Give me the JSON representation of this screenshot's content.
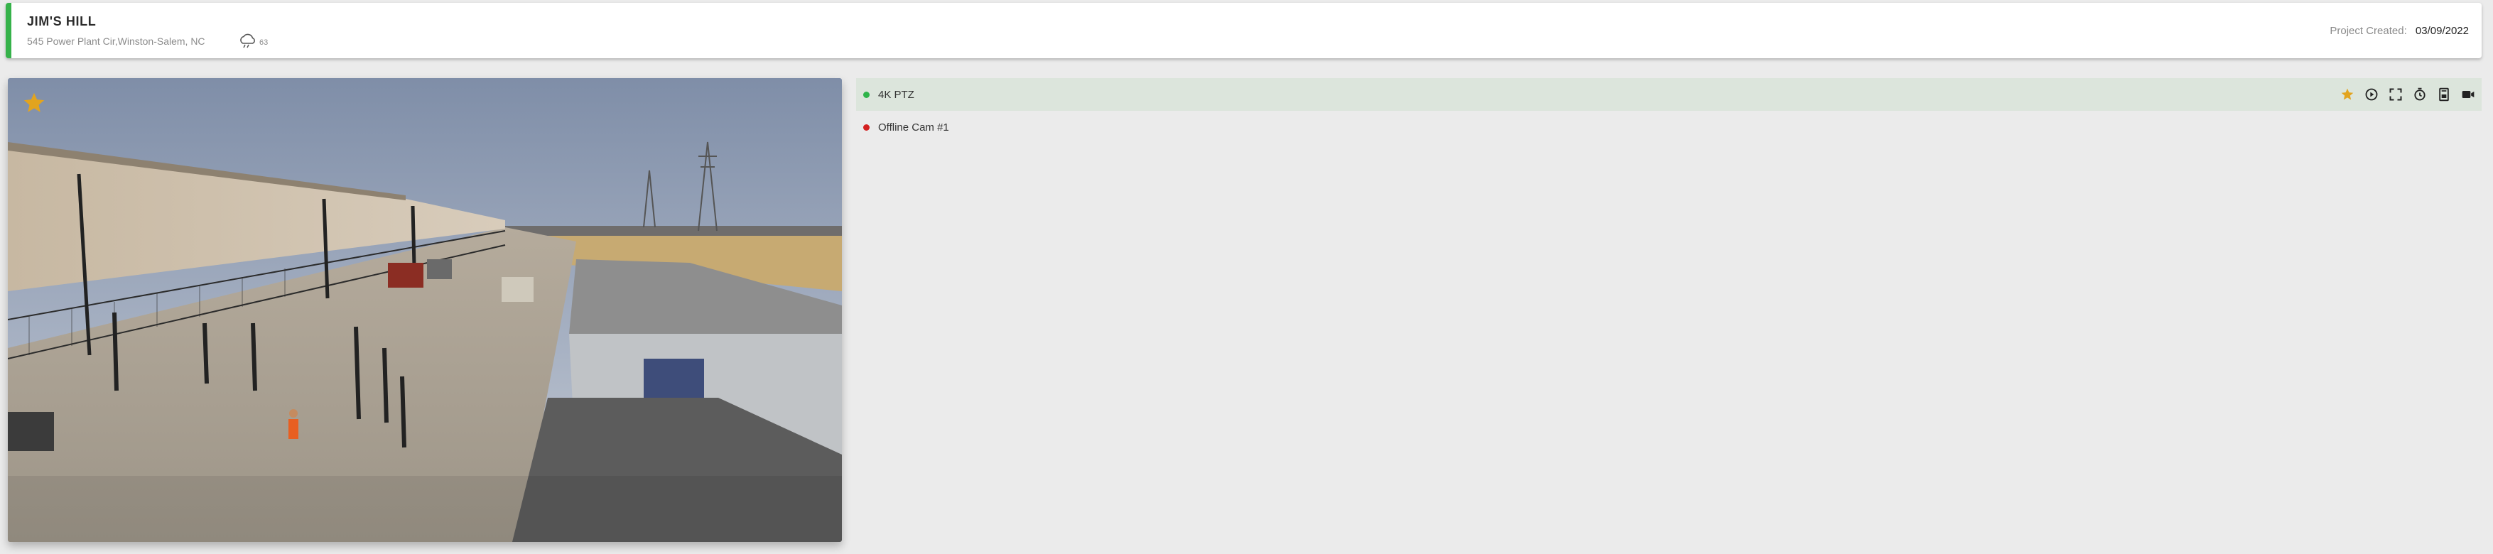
{
  "project": {
    "name": "JIM'S HILL",
    "address": "545 Power Plant Cir,Winston-Salem, NC",
    "temperature": "63",
    "weather_icon": "cloud-rain-icon",
    "created_label": "Project Created:",
    "created_date": "03/09/2022",
    "status_color": "#36b24a"
  },
  "viewer": {
    "favorite_icon": "star-icon",
    "favorite_color": "#e2a41f"
  },
  "cameras": [
    {
      "name": "4K PTZ",
      "status": "online",
      "selected": true,
      "tools": [
        "star-icon",
        "play-icon",
        "fullscreen-icon",
        "timelapse-icon",
        "report-icon",
        "video-camera-icon"
      ]
    },
    {
      "name": "Offline Cam #1",
      "status": "offline",
      "selected": false
    }
  ],
  "colors": {
    "online": "#2fb44a",
    "offline": "#d32020",
    "selected_row": "#dce5dc"
  }
}
